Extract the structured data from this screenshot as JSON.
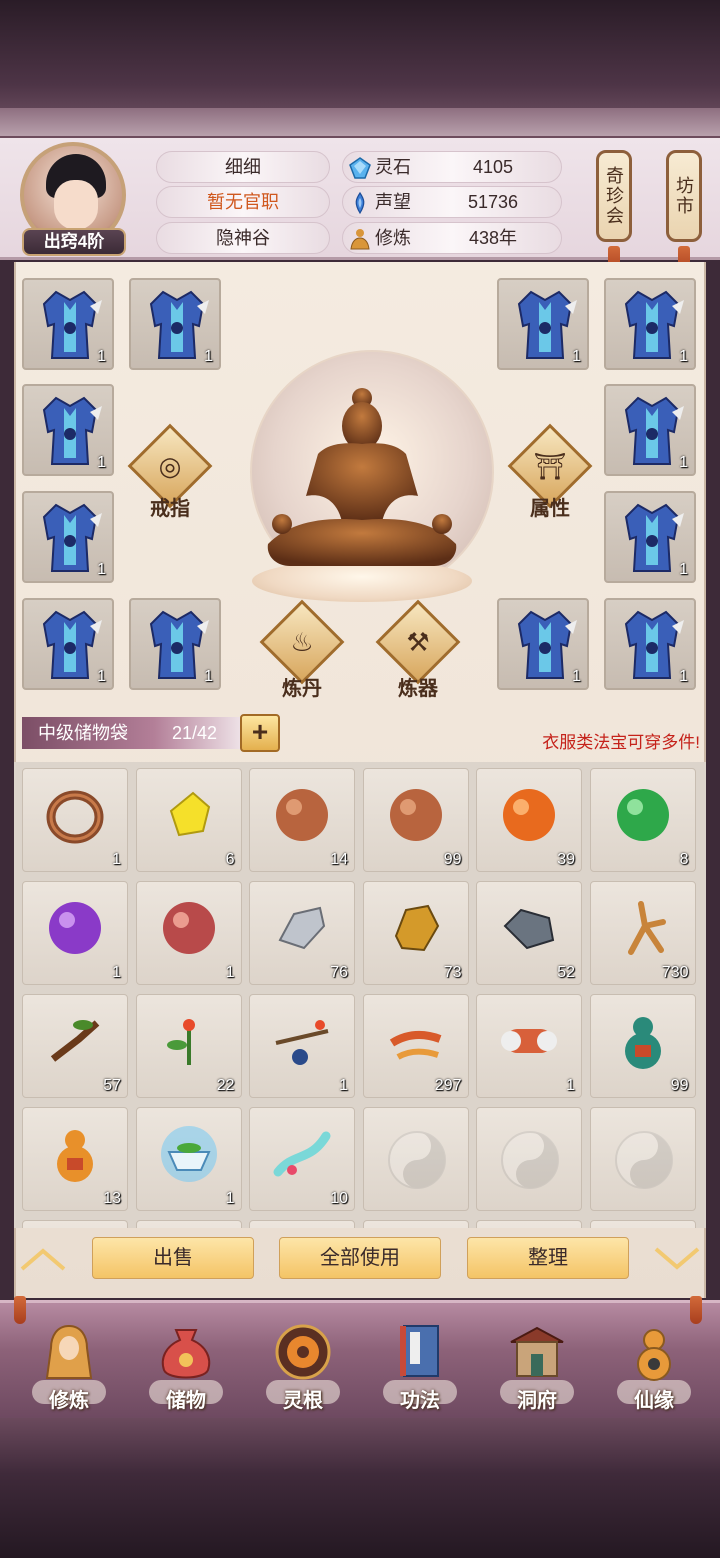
{
  "player": {
    "name": "细细",
    "official_title": "暂无官职",
    "sect": "隐神谷",
    "rank": "出窍4阶"
  },
  "resources": [
    {
      "label": "灵石",
      "value": "4105",
      "icon": "spirit-stone-icon",
      "color": "#4fa6e6"
    },
    {
      "label": "声望",
      "value": "51736",
      "icon": "prestige-icon",
      "color": "#3d7fd8"
    },
    {
      "label": "修炼",
      "value": "438年",
      "icon": "cultivation-icon",
      "color": "#d9963a"
    }
  ],
  "side_buttons": [
    {
      "label": "奇珍会"
    },
    {
      "label": "坊市"
    }
  ],
  "equipment": {
    "slots": [
      {
        "count": "1"
      },
      {
        "count": "1"
      },
      {
        "count": "1"
      },
      {
        "count": "1"
      },
      {
        "count": "1"
      },
      {
        "count": "1"
      },
      {
        "count": "1"
      },
      {
        "count": "1"
      },
      {
        "count": "1"
      },
      {
        "count": "1"
      },
      {
        "count": "1"
      },
      {
        "count": "1"
      }
    ],
    "ring_label": "戒指",
    "attr_label": "属性",
    "alchemy_label": "炼丹",
    "forge_label": "炼器"
  },
  "bag": {
    "name": "中级储物袋",
    "count": "21/42",
    "add_label": "+",
    "hint": "衣服类法宝可穿多件!"
  },
  "inventory": [
    {
      "icon": "ring-item",
      "count": "1"
    },
    {
      "icon": "yellow-crystal",
      "count": "6"
    },
    {
      "icon": "bronze-orb",
      "count": "14"
    },
    {
      "icon": "bronze-orb",
      "count": "99"
    },
    {
      "icon": "orange-orb",
      "count": "39"
    },
    {
      "icon": "green-orb",
      "count": "8"
    },
    {
      "icon": "purple-orb",
      "count": "1"
    },
    {
      "icon": "red-orb",
      "count": "1"
    },
    {
      "icon": "silver-ore",
      "count": "76"
    },
    {
      "icon": "gold-ore",
      "count": "73"
    },
    {
      "icon": "iron-ore",
      "count": "52"
    },
    {
      "icon": "ginseng",
      "count": "730"
    },
    {
      "icon": "root-herb",
      "count": "57"
    },
    {
      "icon": "flower-herb",
      "count": "22"
    },
    {
      "icon": "berry-branch",
      "count": "1"
    },
    {
      "icon": "cordyceps",
      "count": "297"
    },
    {
      "icon": "scroll-bundle",
      "count": "1"
    },
    {
      "icon": "green-gourd",
      "count": "99"
    },
    {
      "icon": "orange-gourd",
      "count": "13"
    },
    {
      "icon": "spirit-bowl",
      "count": "1"
    },
    {
      "icon": "jade-ribbon",
      "count": "10"
    },
    {
      "icon": "empty",
      "count": ""
    },
    {
      "icon": "empty",
      "count": ""
    },
    {
      "icon": "empty",
      "count": ""
    }
  ],
  "actions": {
    "sell": "出售",
    "use_all": "全部使用",
    "sort": "整理"
  },
  "nav": [
    {
      "label": "修炼",
      "icon": "monk-icon"
    },
    {
      "label": "储物",
      "icon": "pouch-icon"
    },
    {
      "label": "灵根",
      "icon": "spirit-root-icon"
    },
    {
      "label": "功法",
      "icon": "book-icon"
    },
    {
      "label": "洞府",
      "icon": "cave-mansion-icon"
    },
    {
      "label": "仙缘",
      "icon": "gourd-icon"
    }
  ]
}
